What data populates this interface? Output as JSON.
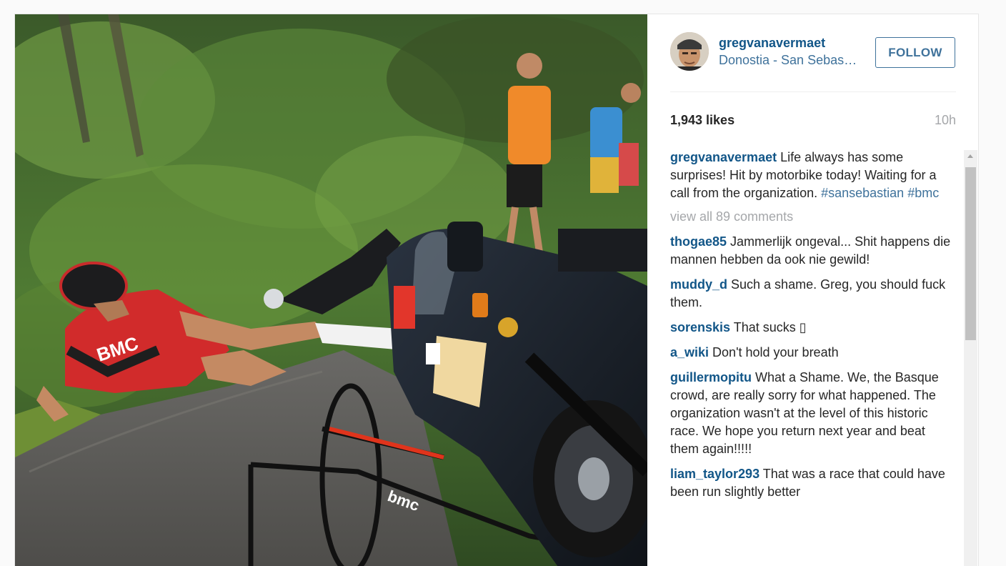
{
  "post": {
    "image_alt": "Cyclist in red BMC kit knocked down beside a fallen police motorbike and bicycle on a wooded mountain road, with spectators standing on the roadside"
  },
  "header": {
    "username": "gregvanavermaet",
    "location": "Donostia - San Sebastián",
    "follow_label": "FOLLOW"
  },
  "stats": {
    "likes": "1,943 likes",
    "time_ago": "10h"
  },
  "caption": {
    "username": "gregvanavermaet",
    "text": " Life always has some surprises! Hit by motorbike today! Waiting for a call from the organization. ",
    "hashtag1": "#sansebastian",
    "hashtag2": "#bmc"
  },
  "view_all_label": "view all 89 comments",
  "comments": [
    {
      "username": "thogae85",
      "text": " Jammerlijk ongeval... Shit happens die mannen hebben da ook nie gewild!"
    },
    {
      "username": "muddy_d",
      "text": " Such a shame. Greg, you should fuck them."
    },
    {
      "username": "sorenskis",
      "text": " That sucks ▯"
    },
    {
      "username": "a_wiki",
      "text": " Don't hold your breath"
    },
    {
      "username": "guillermopitu",
      "text": " What a Shame. We, the Basque crowd, are really sorry for what happened. The organization wasn't at the level of this historic race. We hope you return next year and beat them again!!!!!"
    },
    {
      "username": "liam_taylor293",
      "text": " That was a race that could have been run slightly better"
    }
  ],
  "colors": {
    "username_blue": "#125688",
    "link_blue": "#3f729b",
    "muted_gray": "#a5a7aa",
    "text_dark": "#262626"
  }
}
